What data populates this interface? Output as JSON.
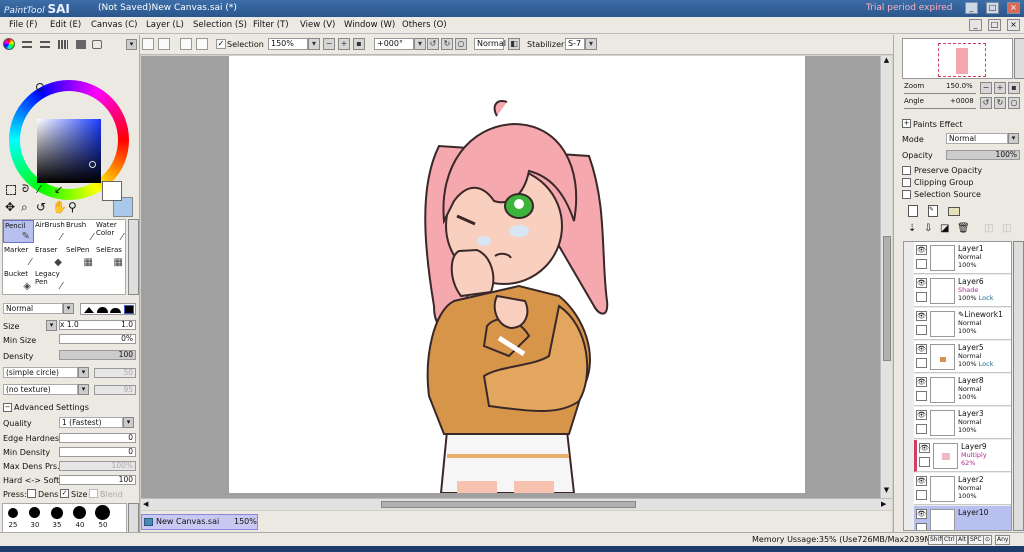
{
  "app": {
    "logo_small": "PaintTool",
    "logo_big": "SAI",
    "document_title": "(Not Saved)New Canvas.sai (*)",
    "trial_notice": "Trial period expired"
  },
  "window_buttons": [
    "_",
    "□",
    "×"
  ],
  "menu": {
    "items": [
      "File (F)",
      "Edit (E)",
      "Canvas (C)",
      "Layer (L)",
      "Selection (S)",
      "Filter (T)",
      "View (V)",
      "Window (W)",
      "Others (O)"
    ],
    "controls": [
      "_",
      "□",
      "×"
    ]
  },
  "toolbar": {
    "selection_label": "Selection",
    "zoom_value": "150%",
    "rotation_value": "+000°",
    "blend_mode": "Normal",
    "stabilizer_label": "Stabilizer",
    "stabilizer_value": "S-7"
  },
  "colors": {
    "primary": "#ffffff",
    "secondary": "#a8c8ec",
    "accent_selection": "#b8c0f0"
  },
  "tools": [
    {
      "label": "Pencil",
      "icon": "pencil-icon"
    },
    {
      "label": "AirBrush",
      "icon": "airbrush-icon"
    },
    {
      "label": "Brush",
      "icon": "brush-icon"
    },
    {
      "label": "Water Color",
      "icon": "watercolor-icon"
    },
    {
      "label": "Marker",
      "icon": "marker-icon"
    },
    {
      "label": "Eraser",
      "icon": "eraser-icon"
    },
    {
      "label": "SelPen",
      "icon": "selpen-icon"
    },
    {
      "label": "SelEras",
      "icon": "seleras-icon"
    },
    {
      "label": "Bucket",
      "icon": "bucket-icon"
    },
    {
      "label": "Legacy Pen",
      "icon": "legacypen-icon"
    }
  ],
  "brush": {
    "mode": "Normal",
    "size_label": "Size",
    "size_mult": "x 1.0",
    "size_value": "1.0",
    "min_size_label": "Min Size",
    "min_size_value": "0%",
    "density_label": "Density",
    "density_value": "100",
    "shape": "(simple circle)",
    "shape_value": "50",
    "texture": "(no texture)",
    "texture_value": "95",
    "advanced_label": "Advanced Settings",
    "quality_label": "Quality",
    "quality_value": "1 (Fastest)",
    "edge_hardness_label": "Edge Hardness",
    "edge_hardness_value": "0",
    "min_density_label": "Min Density",
    "min_density_value": "0",
    "max_dens_label": "Max Dens Prs.",
    "max_dens_value": "100%",
    "hard_soft_label": "Hard <-> Soft",
    "hard_soft_value": "100",
    "press_label": "Press:",
    "press_dens": "Dens",
    "press_size": "Size",
    "press_blend": "Blend",
    "sizes": [
      "25",
      "30",
      "35",
      "40",
      "50"
    ]
  },
  "navigator": {
    "zoom_label": "Zoom",
    "zoom_value": "150.0%",
    "angle_label": "Angle",
    "angle_value": "+0008"
  },
  "layer_panel": {
    "paints_effect": "Paints Effect",
    "mode_label": "Mode",
    "mode_value": "Normal",
    "opacity_label": "Opacity",
    "opacity_value": "100%",
    "preserve_opacity": "Preserve Opacity",
    "clipping_group": "Clipping Group",
    "selection_source": "Selection Source"
  },
  "layers": [
    {
      "name": "Layer1",
      "mode": "Normal",
      "opacity": "100%",
      "lock": ""
    },
    {
      "name": "Layer6",
      "mode": "Shade",
      "opacity": "100%",
      "lock": "Lock"
    },
    {
      "name": "Linework1",
      "mode": "Normal",
      "opacity": "100%",
      "lock": ""
    },
    {
      "name": "Layer5",
      "mode": "Normal",
      "opacity": "100%",
      "lock": "Lock"
    },
    {
      "name": "Layer8",
      "mode": "Normal",
      "opacity": "100%",
      "lock": ""
    },
    {
      "name": "Layer3",
      "mode": "Normal",
      "opacity": "100%",
      "lock": ""
    },
    {
      "name": "Layer9",
      "mode": "Multiply",
      "opacity": "62%",
      "lock": ""
    },
    {
      "name": "Layer2",
      "mode": "Normal",
      "opacity": "100%",
      "lock": ""
    },
    {
      "name": "Layer10",
      "mode": "",
      "opacity": "",
      "lock": ""
    }
  ],
  "tab": {
    "name": "New Canvas.sai",
    "zoom": "150%"
  },
  "status": {
    "memory": "Memory Ussage:35% (Use726MB/Max2039MB)",
    "keys": [
      "Shift",
      "Ctrl",
      "Alt",
      "SPC",
      "⊙",
      "Any"
    ]
  }
}
